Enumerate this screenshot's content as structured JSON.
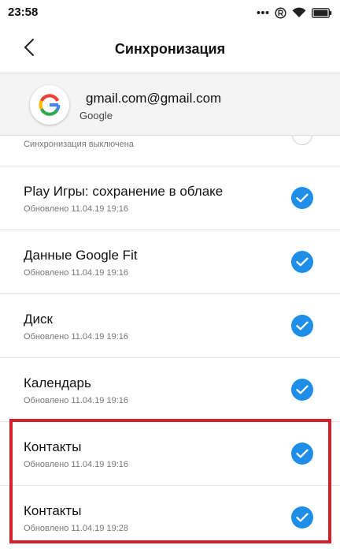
{
  "status_bar": {
    "time": "23:58",
    "icons": [
      "dots-icon",
      "registered-icon",
      "wifi-icon",
      "battery-icon"
    ]
  },
  "header": {
    "title": "Синхронизация",
    "back_icon": "chevron-left-icon"
  },
  "account": {
    "email": "gmail.com@gmail.com",
    "provider": "Google",
    "logo": "google-logo"
  },
  "partial_item": {
    "subtitle": "Синхронизация выключена"
  },
  "items": [
    {
      "title": "Play Игры: сохранение в облаке",
      "subtitle": "Обновлено 11.04.19 19:16",
      "checked": true
    },
    {
      "title": "Данные Google Fit",
      "subtitle": "Обновлено 11.04.19 19:16",
      "checked": true
    },
    {
      "title": "Диск",
      "subtitle": "Обновлено 11.04.19 19:16",
      "checked": true
    },
    {
      "title": "Календарь",
      "subtitle": "Обновлено 11.04.19 19:16",
      "checked": true
    },
    {
      "title": "Контакты",
      "subtitle": "Обновлено 11.04.19 19:16",
      "checked": true
    },
    {
      "title": "Контакты",
      "subtitle": "Обновлено 11.04.19 19:28",
      "checked": true
    }
  ],
  "colors": {
    "accent": "#1f8ee8",
    "highlight": "#d4202a",
    "banner_bg": "#f4f4f4"
  }
}
